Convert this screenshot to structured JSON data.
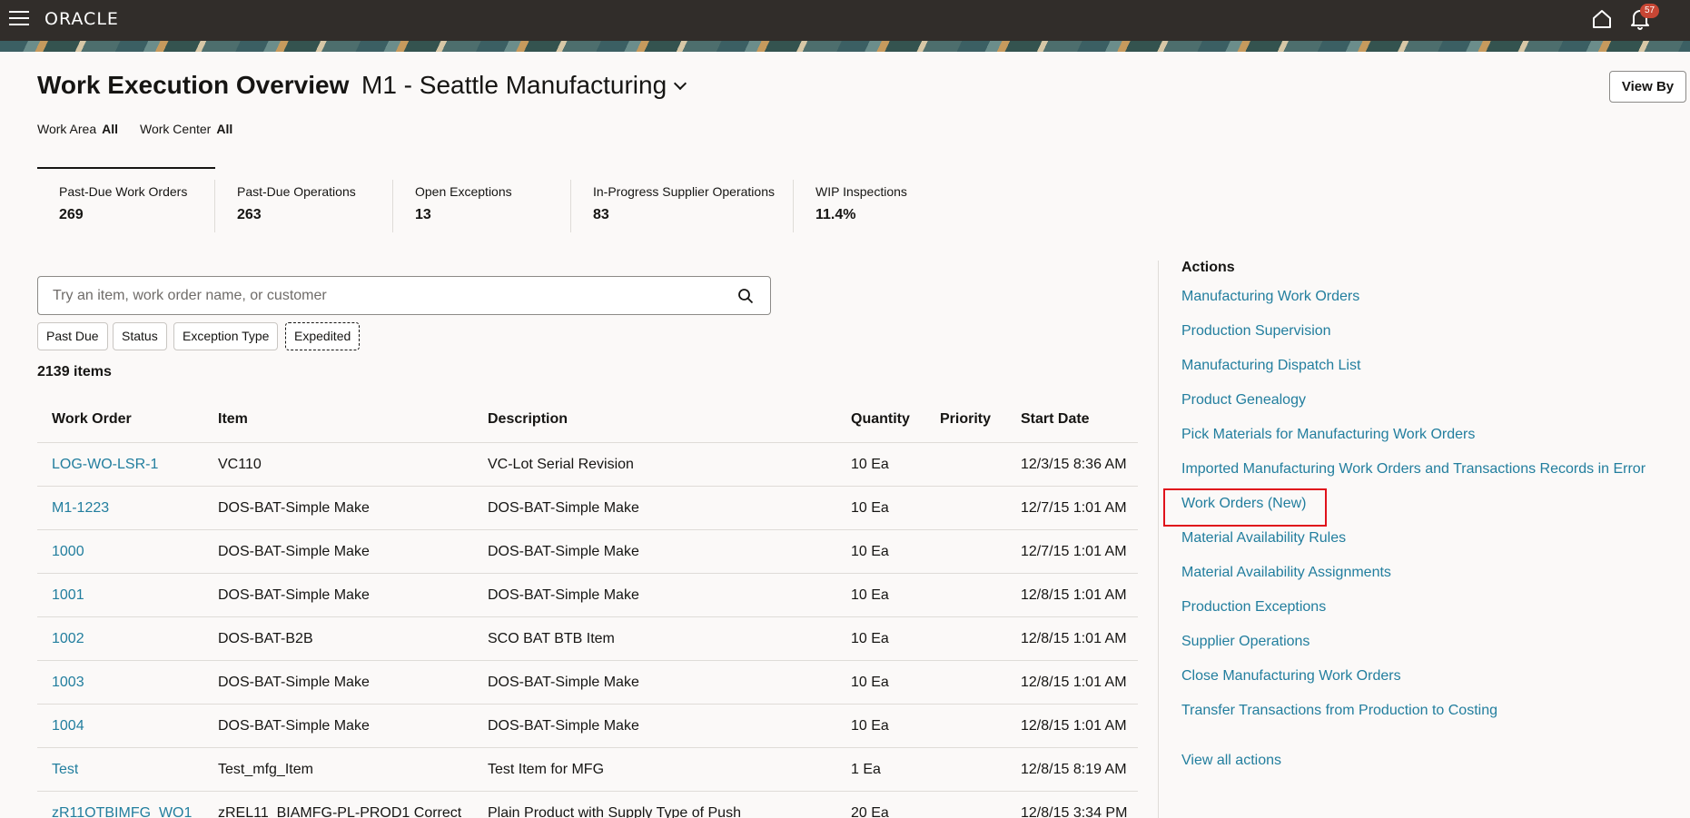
{
  "topbar": {
    "logo": "ORACLE",
    "notifications_count": "57"
  },
  "header": {
    "title": "Work Execution Overview",
    "organization": "M1 - Seattle Manufacturing",
    "view_by_label": "View By"
  },
  "filters": {
    "work_area_label": "Work Area",
    "work_area_value": "All",
    "work_center_label": "Work Center",
    "work_center_value": "All"
  },
  "metrics": [
    {
      "label": "Past-Due Work Orders",
      "value": "269"
    },
    {
      "label": "Past-Due Operations",
      "value": "263"
    },
    {
      "label": "Open Exceptions",
      "value": "13"
    },
    {
      "label": "In-Progress Supplier Operations",
      "value": "83"
    },
    {
      "label": "WIP Inspections",
      "value": "11.4%"
    }
  ],
  "search": {
    "placeholder": "Try an item, work order name, or customer"
  },
  "chips": [
    "Past Due",
    "Status",
    "Exception Type",
    "Expedited"
  ],
  "item_count": "2139 items",
  "table": {
    "columns": [
      "Work Order",
      "Item",
      "Description",
      "Quantity",
      "Priority",
      "Start Date"
    ],
    "rows": [
      [
        "LOG-WO-LSR-1",
        "VC110",
        "VC-Lot Serial Revision",
        "10 Ea",
        "",
        "12/3/15 8:36 AM"
      ],
      [
        "M1-1223",
        "DOS-BAT-Simple Make",
        "DOS-BAT-Simple Make",
        "10 Ea",
        "",
        "12/7/15 1:01 AM"
      ],
      [
        "1000",
        "DOS-BAT-Simple Make",
        "DOS-BAT-Simple Make",
        "10 Ea",
        "",
        "12/7/15 1:01 AM"
      ],
      [
        "1001",
        "DOS-BAT-Simple Make",
        "DOS-BAT-Simple Make",
        "10 Ea",
        "",
        "12/8/15 1:01 AM"
      ],
      [
        "1002",
        "DOS-BAT-B2B",
        "SCO BAT BTB Item",
        "10 Ea",
        "",
        "12/8/15 1:01 AM"
      ],
      [
        "1003",
        "DOS-BAT-Simple Make",
        "DOS-BAT-Simple Make",
        "10 Ea",
        "",
        "12/8/15 1:01 AM"
      ],
      [
        "1004",
        "DOS-BAT-Simple Make",
        "DOS-BAT-Simple Make",
        "10 Ea",
        "",
        "12/8/15 1:01 AM"
      ],
      [
        "Test",
        "Test_mfg_Item",
        "Test Item for MFG",
        "1 Ea",
        "",
        "12/8/15 8:19 AM"
      ],
      [
        "zR11OTBIMFG_WO1",
        "zREL11_BIAMFG-PL-PROD1 Correct",
        "Plain Product with Supply Type of Push",
        "20 Ea",
        "",
        "12/8/15 3:34 PM"
      ]
    ]
  },
  "actions": {
    "title": "Actions",
    "items": [
      "Manufacturing Work Orders",
      "Production Supervision",
      "Manufacturing Dispatch List",
      "Product Genealogy",
      "Pick Materials for Manufacturing Work Orders",
      "Imported Manufacturing Work Orders and Transactions Records in Error",
      "Work Orders (New)",
      "Material Availability Rules",
      "Material Availability Assignments",
      "Production Exceptions",
      "Supplier Operations",
      "Close Manufacturing Work Orders",
      "Transfer Transactions from Production to Costing"
    ],
    "view_all": "View all actions"
  },
  "colors": {
    "topbar": "#312d2a",
    "link": "#227e9e",
    "highlight": "#e0121b",
    "badge": "#c74634"
  }
}
